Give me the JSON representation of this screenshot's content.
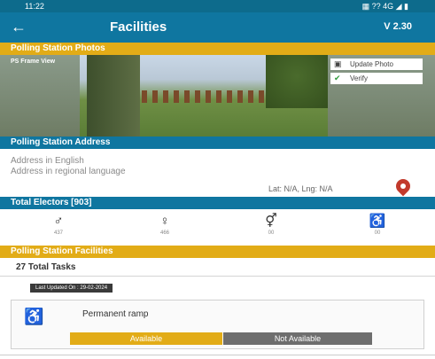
{
  "status_bar": {
    "time": "11:22",
    "indicators": "▦ ?? 4G ◢ ▮"
  },
  "app_bar": {
    "title": "Facilities",
    "version": "V 2.30",
    "back_icon": "arrow-left-icon"
  },
  "photos_section": {
    "header": "Polling Station Photos",
    "caption": "PS Frame View",
    "update_label": "Update Photo",
    "verify_label": "Verify"
  },
  "address_section": {
    "header": "Polling Station Address",
    "address_english": "Address in English",
    "address_regional": "Address in regional language",
    "latlng": "Lat: N/A, Lng: N/A"
  },
  "electors": {
    "header": "Total Electors [903]",
    "items": [
      {
        "icon": "male-icon",
        "count": "437"
      },
      {
        "icon": "female-icon",
        "count": "466"
      },
      {
        "icon": "third-gender-icon",
        "count": "00"
      },
      {
        "icon": "wheelchair-icon",
        "count": "00"
      }
    ]
  },
  "facilities": {
    "header": "Polling Station Facilities",
    "total_tasks": "27 Total Tasks",
    "last_updated": "Last Updated On : 29-02-2024",
    "card": {
      "title": "Permanent ramp",
      "available_label": "Available",
      "not_available_label": "Not Available"
    }
  },
  "colors": {
    "primary": "#0f76a0",
    "accent": "#e2ac17",
    "muted": "#6e6e6e"
  }
}
